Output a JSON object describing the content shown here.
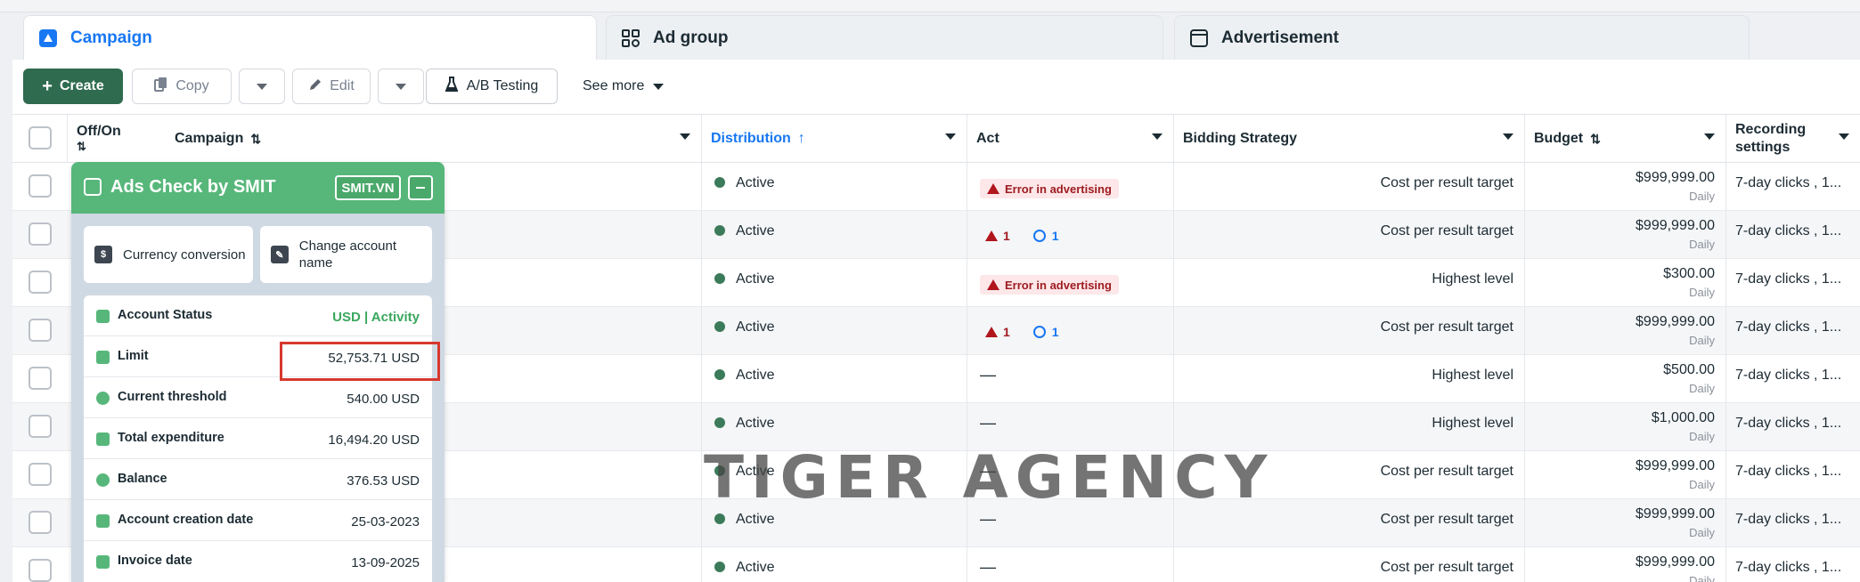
{
  "tabs": [
    {
      "label": "Campaign",
      "icon": "campaign-icon"
    },
    {
      "label": "Ad group",
      "icon": "grid-icon"
    },
    {
      "label": "Advertisement",
      "icon": "window-icon"
    }
  ],
  "toolbar": {
    "create": "Create",
    "copy": "Copy",
    "edit": "Edit",
    "ab_testing": "A/B Testing",
    "see_more": "See more"
  },
  "columns": {
    "offon": "Off/On",
    "campaign": "Campaign",
    "distribution": "Distribution",
    "act": "Act",
    "bidding": "Bidding Strategy",
    "budget": "Budget",
    "recording": "Recording settings"
  },
  "rows": [
    {
      "distribution": "Active",
      "act_type": "error",
      "act_text": "Error in advertising",
      "bidding": "Cost per result target",
      "budget": "$999,999.00",
      "period": "Daily",
      "recording": "7-day clicks , 1..."
    },
    {
      "distribution": "Active",
      "act_type": "counts",
      "warn_count": "1",
      "info_count": "1",
      "bidding": "Cost per result target",
      "budget": "$999,999.00",
      "period": "Daily",
      "recording": "7-day clicks , 1..."
    },
    {
      "distribution": "Active",
      "act_type": "error",
      "act_text": "Error in advertising",
      "bidding": "Highest level",
      "budget": "$300.00",
      "period": "Daily",
      "recording": "7-day clicks , 1..."
    },
    {
      "distribution": "Active",
      "act_type": "counts",
      "warn_count": "1",
      "info_count": "1",
      "bidding": "Cost per result target",
      "budget": "$999,999.00",
      "period": "Daily",
      "recording": "7-day clicks , 1..."
    },
    {
      "distribution": "Active",
      "act_type": "dash",
      "act_text": "—",
      "bidding": "Highest level",
      "budget": "$500.00",
      "period": "Daily",
      "recording": "7-day clicks , 1..."
    },
    {
      "distribution": "Active",
      "act_type": "dash",
      "act_text": "—",
      "bidding": "Highest level",
      "budget": "$1,000.00",
      "period": "Daily",
      "recording": "7-day clicks , 1..."
    },
    {
      "distribution": "Active",
      "act_type": "dash",
      "act_text": "—",
      "bidding": "Cost per result target",
      "budget": "$999,999.00",
      "period": "Daily",
      "recording": "7-day clicks , 1..."
    },
    {
      "distribution": "Active",
      "act_type": "dash",
      "act_text": "—",
      "bidding": "Cost per result target",
      "budget": "$999,999.00",
      "period": "Daily",
      "recording": "7-day clicks , 1..."
    },
    {
      "distribution": "Active",
      "act_type": "dash",
      "act_text": "—",
      "bidding": "Cost per result target",
      "budget": "$999,999.00",
      "period": "Daily",
      "recording": "7-day clicks , 1..."
    }
  ],
  "panel": {
    "title": "Ads Check by SMIT",
    "badge": "SMIT.VN",
    "btn_currency": "Currency conversion",
    "btn_change": "Change account name",
    "items": [
      {
        "label": "Account Status",
        "value": "USD | Activity"
      },
      {
        "label": "Limit",
        "value": "52,753.71 USD"
      },
      {
        "label": "Current threshold",
        "value": "540.00 USD"
      },
      {
        "label": "Total expenditure",
        "value": "16,494.20 USD"
      },
      {
        "label": "Balance",
        "value": "376.53 USD"
      },
      {
        "label": "Account creation date",
        "value": "25-03-2023"
      },
      {
        "label": "Invoice date",
        "value": "13-09-2025"
      }
    ]
  },
  "watermark": "TIGER AGENCY",
  "colors": {
    "accent": "#1877f2",
    "create": "#2f6b4f",
    "panel_green": "#57b77a",
    "error": "#b0161c",
    "highlight": "#d7382f"
  }
}
